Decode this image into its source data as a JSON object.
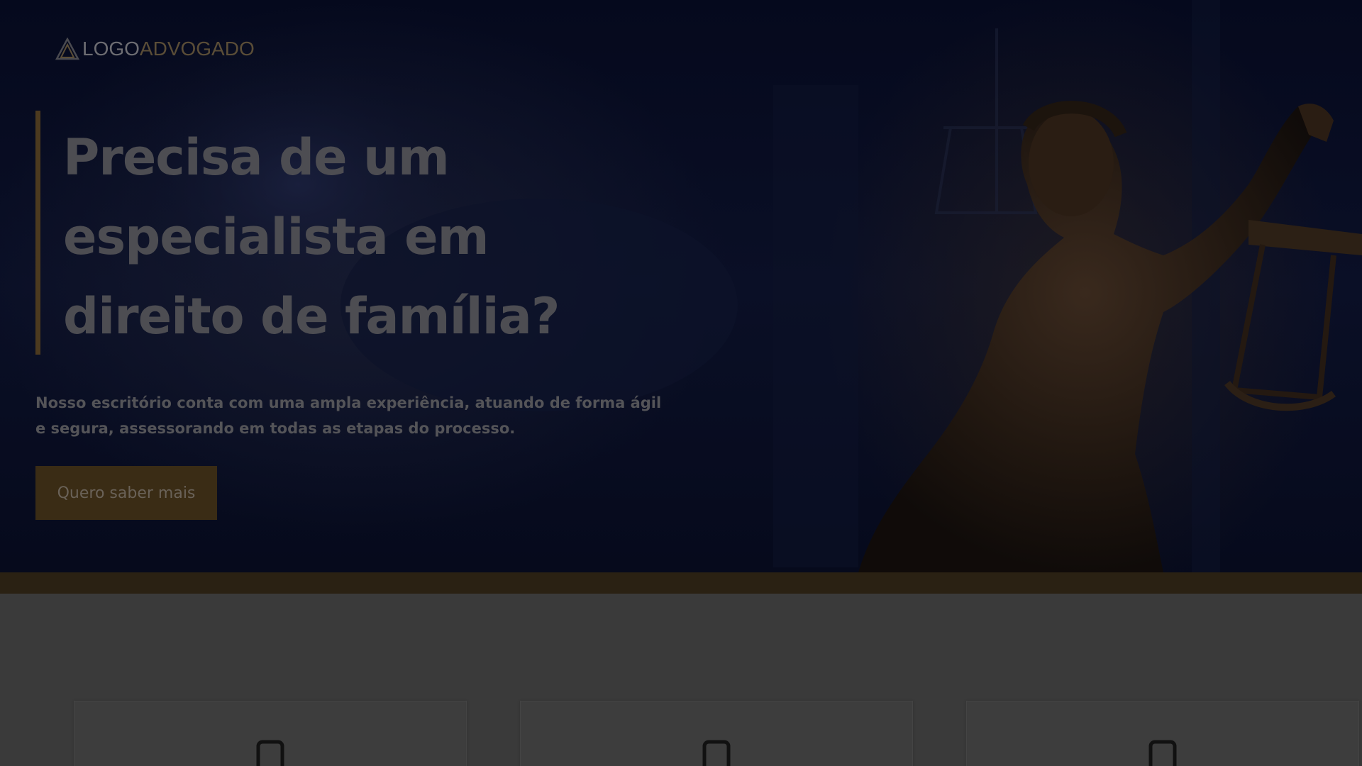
{
  "header": {
    "logo_text_bold": "LOGO",
    "logo_text_light": "ADVOGADO",
    "logo_icon": "triangle-logo-icon"
  },
  "hero": {
    "headline": "Precisa de um especialista em direito de família?",
    "subtext": "Nosso escritório conta com uma ampla experiência, atuando de forma ágil e segura, assessorando em todas as etapas do processo.",
    "cta_label": "Quero saber mais",
    "background_image": "lady-justice-statue-with-scales"
  },
  "colors": {
    "hero_bg": "#05091d",
    "accent_gold": "#4c3a1f",
    "button_bg": "#3a2c15",
    "band": "#2a2113",
    "section_bg": "#3a3a3a"
  },
  "features": {
    "cards": [
      {
        "icon": "smartphone-icon"
      },
      {
        "icon": "smartphone-icon"
      },
      {
        "icon": "smartphone-icon"
      }
    ]
  }
}
